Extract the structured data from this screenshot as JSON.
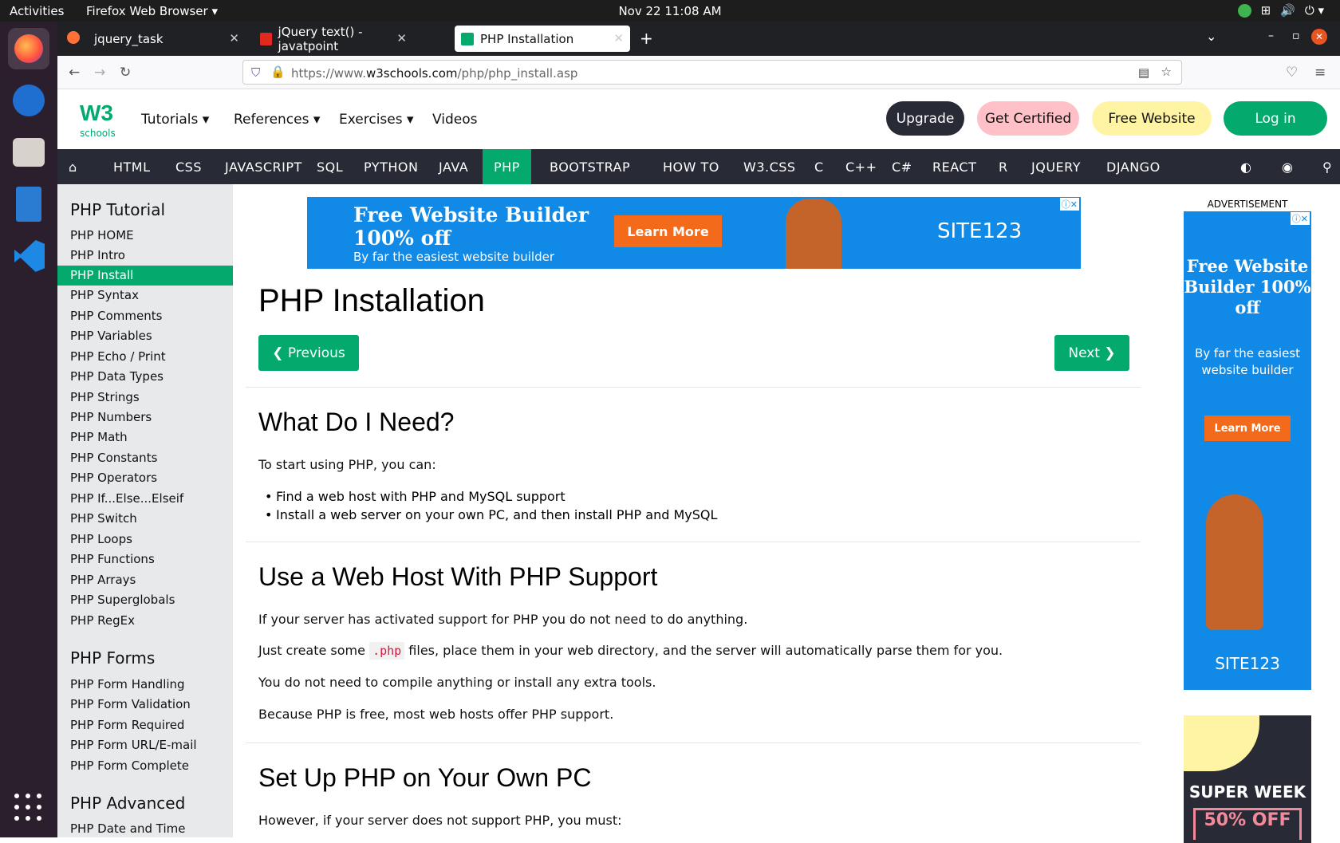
{
  "system": {
    "activities": "Activities",
    "browser_name": "Firefox Web Browser",
    "clock": "Nov 22  11:08 AM"
  },
  "tabs": [
    {
      "title": "jquery_task"
    },
    {
      "title": "jQuery text() - javatpoint"
    },
    {
      "title": "PHP Installation"
    }
  ],
  "url": {
    "prefix": "https://www.",
    "domain": "w3schools.com",
    "path": "/php/php_install.asp"
  },
  "header": {
    "logo_w3": "W3",
    "logo_schools": "schools",
    "menu": [
      "Tutorials ▾",
      "References ▾",
      "Exercises ▾",
      "Videos"
    ],
    "buttons": {
      "upgrade": "Upgrade",
      "certified": "Get Certified",
      "free_website": "Free Website",
      "login": "Log in"
    }
  },
  "topnav": [
    "HTML",
    "CSS",
    "JAVASCRIPT",
    "SQL",
    "PYTHON",
    "JAVA",
    "PHP",
    "BOOTSTRAP",
    "HOW TO",
    "W3.CSS",
    "C",
    "C++",
    "C#",
    "REACT",
    "R",
    "JQUERY",
    "DJANGO"
  ],
  "sidebar": {
    "heading1": "PHP Tutorial",
    "items1": [
      "PHP HOME",
      "PHP Intro",
      "PHP Install",
      "PHP Syntax",
      "PHP Comments",
      "PHP Variables",
      "PHP Echo / Print",
      "PHP Data Types",
      "PHP Strings",
      "PHP Numbers",
      "PHP Math",
      "PHP Constants",
      "PHP Operators",
      "PHP If...Else...Elseif",
      "PHP Switch",
      "PHP Loops",
      "PHP Functions",
      "PHP Arrays",
      "PHP Superglobals",
      "PHP RegEx"
    ],
    "heading2": "PHP Forms",
    "items2": [
      "PHP Form Handling",
      "PHP Form Validation",
      "PHP Form Required",
      "PHP Form URL/E-mail",
      "PHP Form Complete"
    ],
    "heading3": "PHP Advanced",
    "items3": [
      "PHP Date and Time"
    ]
  },
  "ad_banner": {
    "title1": "Free Website Builder",
    "title2": "100% off",
    "subtitle": "By far the easiest website builder",
    "button": "Learn More",
    "brand": "SITE123"
  },
  "content": {
    "title": "PHP Installation",
    "prev": "❮ Previous",
    "next": "Next ❯",
    "h2_need": "What Do I Need?",
    "p_start": "To start using PHP, you can:",
    "bullets": [
      "Find a web host with PHP and MySQL support",
      "Install a web server on your own PC, and then install PHP and MySQL"
    ],
    "h2_host": "Use a Web Host With PHP Support",
    "p_host1": "If your server has activated support for PHP you do not need to do anything.",
    "p_host2a": "Just create some ",
    "p_host2code": ".php",
    "p_host2b": " files, place them in your web directory, and the server will automatically parse them for you.",
    "p_host3": "You do not need to compile anything or install any extra tools.",
    "p_host4": "Because PHP is free, most web hosts offer PHP support.",
    "h2_own": "Set Up PHP on Your Own PC",
    "p_own": "However, if your server does not support PHP, you must:"
  },
  "right_ad": {
    "label": "ADVERTISEMENT",
    "title": "Free Website Builder 100% off",
    "body": "By far the easiest website builder",
    "button": "Learn More",
    "brand": "SITE123",
    "promo": "SUPER WEEK",
    "promo_off": "50% OFF"
  }
}
